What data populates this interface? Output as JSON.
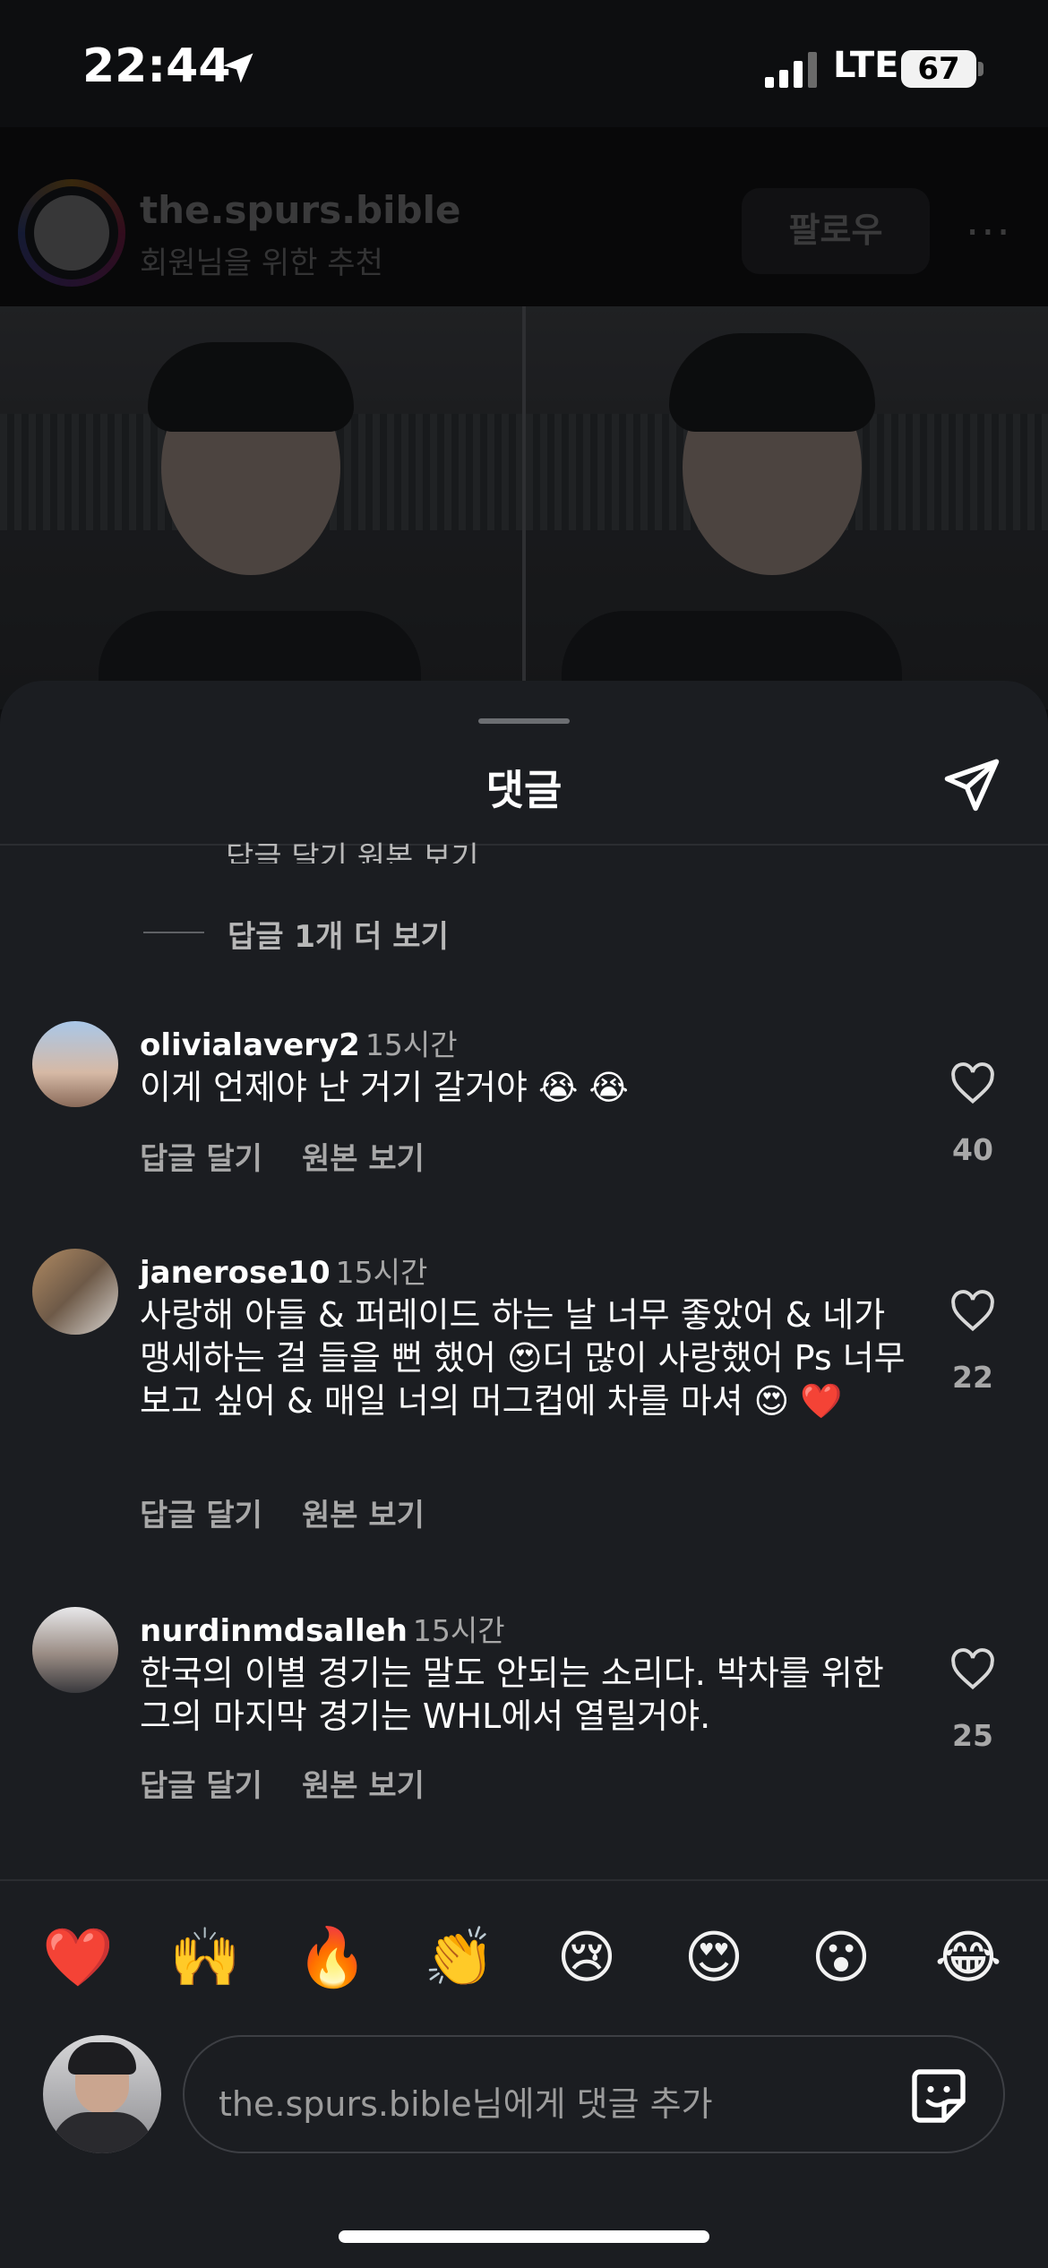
{
  "status_bar": {
    "time": "22:44",
    "network": "LTE",
    "battery": "67"
  },
  "post": {
    "account": "the.spurs.bible",
    "subtitle": "회원님을 위한 추천",
    "follow_label": "팔로우",
    "more_label": "···"
  },
  "sheet": {
    "title": "댓글",
    "cut_actions": "답글 달기    원본 보기",
    "view_more_replies": "답글 1개 더 보기"
  },
  "comments": [
    {
      "user": "olivialavery2",
      "time": "15시간",
      "text": "이게 언제야 난 거기 갈거야 😭 😭",
      "reply": "답글 달기",
      "original": "원본 보기",
      "likes": "40"
    },
    {
      "user": "janerose10",
      "time": "15시간",
      "text": "사랑해 아들 & 퍼레이드 하는 날 너무 좋았어 & 네가 맹세하는 걸 들을 뻔 했어 😍더 많이 사랑했어 Ps 너무 보고 싶어 & 매일 너의 머그컵에 차를 마셔 😍 ❤️",
      "reply": "답글 달기",
      "original": "원본 보기",
      "likes": "22"
    },
    {
      "user": "nurdinmdsalleh",
      "time": "15시간",
      "text": "한국의 이별 경기는 말도 안되는 소리다. 박차를 위한 그의 마지막 경기는 WHL에서 열릴거야.",
      "reply": "답글 달기",
      "original": "원본 보기",
      "likes": "25"
    }
  ],
  "emoji_bar": [
    "❤️",
    "🙌",
    "🔥",
    "👏",
    "😢",
    "😍",
    "😮",
    "😂"
  ],
  "composer": {
    "placeholder": "the.spurs.bible님에게 댓글 추가"
  },
  "icons": {
    "location": "location-arrow-icon",
    "send": "paper-plane-icon",
    "heart": "heart-outline-icon",
    "sticker": "sticker-icon"
  }
}
